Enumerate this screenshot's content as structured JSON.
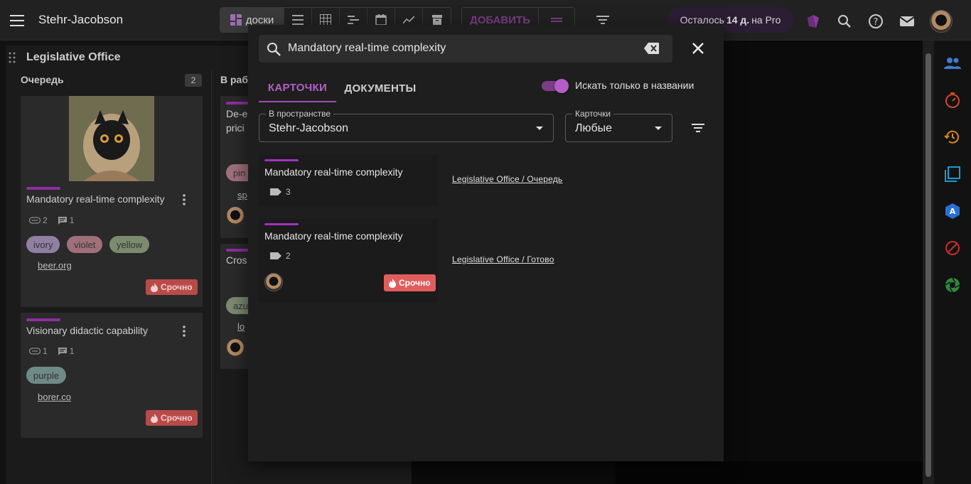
{
  "header": {
    "app_title": "Stehr-Jacobson",
    "boards_label": "доски",
    "add_label": "ДОБАВИТЬ",
    "pro_prefix": "Осталось",
    "pro_days": "14 д.",
    "pro_suffix": "на Pro"
  },
  "board": {
    "title": "Legislative Office",
    "columns": [
      {
        "name": "Очередь",
        "count": "2"
      },
      {
        "name": "В рабо"
      }
    ],
    "cards": [
      {
        "title": "Mandatory real-time complexity",
        "attachments": "2",
        "comments": "1",
        "tags": [
          "ivory",
          "violet",
          "yellow"
        ],
        "link": "beer.org",
        "urgent": "Срочно"
      },
      {
        "title": "Visionary didactic capability",
        "attachments": "1",
        "comments": "1",
        "tags": [
          "purple"
        ],
        "link": "borer.co",
        "urgent": "Срочно"
      }
    ],
    "col2_partial": {
      "title_line1": "De-e",
      "title_line2": "prici",
      "tag": "pin",
      "link": "sp",
      "title2": "Cros",
      "tag2": "azu",
      "link2": "lo"
    }
  },
  "search": {
    "query": "Mandatory real-time complexity",
    "tabs": [
      {
        "label": "КАРТОЧКИ",
        "active": true
      },
      {
        "label": "ДОКУМЕНТЫ",
        "active": false
      }
    ],
    "toggle_label": "Искать только в названии",
    "space_select": {
      "legend": "В пространстве",
      "value": "Stehr-Jacobson"
    },
    "cards_select": {
      "legend": "Карточки",
      "value": "Любые"
    },
    "results": [
      {
        "title": "Mandatory real-time complexity",
        "tags_count": "3",
        "path": "Legislative Office / Очередь"
      },
      {
        "title": "Mandatory real-time complexity",
        "tags_count": "2",
        "path": "Legislative Office / Готово",
        "urgent": "Срочно"
      }
    ]
  },
  "colors": {
    "accent": "#a447b8",
    "urgent": "#e05d5d",
    "background": "#121212"
  }
}
